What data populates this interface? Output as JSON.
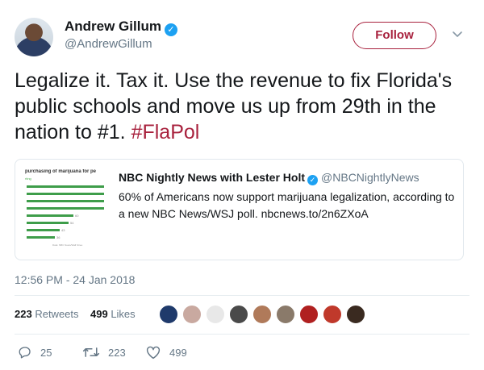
{
  "author": {
    "name": "Andrew Gillum",
    "handle": "@AndrewGillum",
    "verified": true
  },
  "follow_label": "Follow",
  "tweet": {
    "text": "Legalize it. Tax it. Use the revenue to fix Florida's public schools and move us up from 29th in the nation to #1.",
    "hashtag": "#FlaPol"
  },
  "quote": {
    "image": {
      "title": "purchasing of marijuana for pe",
      "subtitle": "rting",
      "bar_values": [
        100,
        100,
        100,
        100,
        60,
        54,
        43,
        36
      ],
      "bar_labels": [
        "",
        "",
        "",
        "",
        "60",
        "54",
        "43",
        "36"
      ],
      "source": "Data: NBC News/Wall Stree"
    },
    "author_name": "NBC Nightly News with Lester Holt",
    "author_handle": "@NBCNightlyNews",
    "text": "60% of Americans now support marijuana legalization, according to a new NBC News/WSJ poll. nbcnews.to/2n6ZXoA"
  },
  "timestamp": "12:56 PM - 24 Jan 2018",
  "stats": {
    "retweets_count": "223",
    "retweets_label": "Retweets",
    "likes_count": "499",
    "likes_label": "Likes"
  },
  "liker_colors": [
    "#1f3a6b",
    "#c9a9a0",
    "#e8e8e8",
    "#4a4a4a",
    "#b07a5a",
    "#8a7a6a",
    "#b02020",
    "#c0392b",
    "#3a2a20"
  ],
  "actions": {
    "reply_count": "25",
    "retweet_count": "223",
    "like_count": "499"
  },
  "colors": {
    "accent": "#a8213d",
    "verified": "#1da1f2",
    "muted": "#657786"
  }
}
